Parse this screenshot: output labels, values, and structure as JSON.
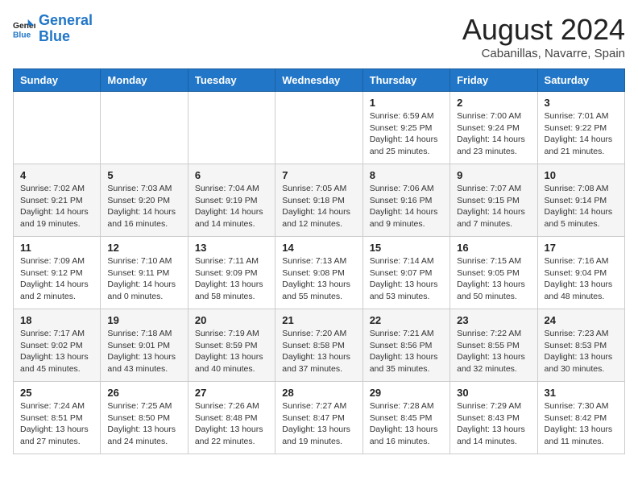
{
  "header": {
    "logo_line1": "General",
    "logo_line2": "Blue",
    "month_year": "August 2024",
    "location": "Cabanillas, Navarre, Spain"
  },
  "weekdays": [
    "Sunday",
    "Monday",
    "Tuesday",
    "Wednesday",
    "Thursday",
    "Friday",
    "Saturday"
  ],
  "weeks": [
    [
      {
        "day": "",
        "info": ""
      },
      {
        "day": "",
        "info": ""
      },
      {
        "day": "",
        "info": ""
      },
      {
        "day": "",
        "info": ""
      },
      {
        "day": "1",
        "info": "Sunrise: 6:59 AM\nSunset: 9:25 PM\nDaylight: 14 hours\nand 25 minutes."
      },
      {
        "day": "2",
        "info": "Sunrise: 7:00 AM\nSunset: 9:24 PM\nDaylight: 14 hours\nand 23 minutes."
      },
      {
        "day": "3",
        "info": "Sunrise: 7:01 AM\nSunset: 9:22 PM\nDaylight: 14 hours\nand 21 minutes."
      }
    ],
    [
      {
        "day": "4",
        "info": "Sunrise: 7:02 AM\nSunset: 9:21 PM\nDaylight: 14 hours\nand 19 minutes."
      },
      {
        "day": "5",
        "info": "Sunrise: 7:03 AM\nSunset: 9:20 PM\nDaylight: 14 hours\nand 16 minutes."
      },
      {
        "day": "6",
        "info": "Sunrise: 7:04 AM\nSunset: 9:19 PM\nDaylight: 14 hours\nand 14 minutes."
      },
      {
        "day": "7",
        "info": "Sunrise: 7:05 AM\nSunset: 9:18 PM\nDaylight: 14 hours\nand 12 minutes."
      },
      {
        "day": "8",
        "info": "Sunrise: 7:06 AM\nSunset: 9:16 PM\nDaylight: 14 hours\nand 9 minutes."
      },
      {
        "day": "9",
        "info": "Sunrise: 7:07 AM\nSunset: 9:15 PM\nDaylight: 14 hours\nand 7 minutes."
      },
      {
        "day": "10",
        "info": "Sunrise: 7:08 AM\nSunset: 9:14 PM\nDaylight: 14 hours\nand 5 minutes."
      }
    ],
    [
      {
        "day": "11",
        "info": "Sunrise: 7:09 AM\nSunset: 9:12 PM\nDaylight: 14 hours\nand 2 minutes."
      },
      {
        "day": "12",
        "info": "Sunrise: 7:10 AM\nSunset: 9:11 PM\nDaylight: 14 hours\nand 0 minutes."
      },
      {
        "day": "13",
        "info": "Sunrise: 7:11 AM\nSunset: 9:09 PM\nDaylight: 13 hours\nand 58 minutes."
      },
      {
        "day": "14",
        "info": "Sunrise: 7:13 AM\nSunset: 9:08 PM\nDaylight: 13 hours\nand 55 minutes."
      },
      {
        "day": "15",
        "info": "Sunrise: 7:14 AM\nSunset: 9:07 PM\nDaylight: 13 hours\nand 53 minutes."
      },
      {
        "day": "16",
        "info": "Sunrise: 7:15 AM\nSunset: 9:05 PM\nDaylight: 13 hours\nand 50 minutes."
      },
      {
        "day": "17",
        "info": "Sunrise: 7:16 AM\nSunset: 9:04 PM\nDaylight: 13 hours\nand 48 minutes."
      }
    ],
    [
      {
        "day": "18",
        "info": "Sunrise: 7:17 AM\nSunset: 9:02 PM\nDaylight: 13 hours\nand 45 minutes."
      },
      {
        "day": "19",
        "info": "Sunrise: 7:18 AM\nSunset: 9:01 PM\nDaylight: 13 hours\nand 43 minutes."
      },
      {
        "day": "20",
        "info": "Sunrise: 7:19 AM\nSunset: 8:59 PM\nDaylight: 13 hours\nand 40 minutes."
      },
      {
        "day": "21",
        "info": "Sunrise: 7:20 AM\nSunset: 8:58 PM\nDaylight: 13 hours\nand 37 minutes."
      },
      {
        "day": "22",
        "info": "Sunrise: 7:21 AM\nSunset: 8:56 PM\nDaylight: 13 hours\nand 35 minutes."
      },
      {
        "day": "23",
        "info": "Sunrise: 7:22 AM\nSunset: 8:55 PM\nDaylight: 13 hours\nand 32 minutes."
      },
      {
        "day": "24",
        "info": "Sunrise: 7:23 AM\nSunset: 8:53 PM\nDaylight: 13 hours\nand 30 minutes."
      }
    ],
    [
      {
        "day": "25",
        "info": "Sunrise: 7:24 AM\nSunset: 8:51 PM\nDaylight: 13 hours\nand 27 minutes."
      },
      {
        "day": "26",
        "info": "Sunrise: 7:25 AM\nSunset: 8:50 PM\nDaylight: 13 hours\nand 24 minutes."
      },
      {
        "day": "27",
        "info": "Sunrise: 7:26 AM\nSunset: 8:48 PM\nDaylight: 13 hours\nand 22 minutes."
      },
      {
        "day": "28",
        "info": "Sunrise: 7:27 AM\nSunset: 8:47 PM\nDaylight: 13 hours\nand 19 minutes."
      },
      {
        "day": "29",
        "info": "Sunrise: 7:28 AM\nSunset: 8:45 PM\nDaylight: 13 hours\nand 16 minutes."
      },
      {
        "day": "30",
        "info": "Sunrise: 7:29 AM\nSunset: 8:43 PM\nDaylight: 13 hours\nand 14 minutes."
      },
      {
        "day": "31",
        "info": "Sunrise: 7:30 AM\nSunset: 8:42 PM\nDaylight: 13 hours\nand 11 minutes."
      }
    ]
  ]
}
